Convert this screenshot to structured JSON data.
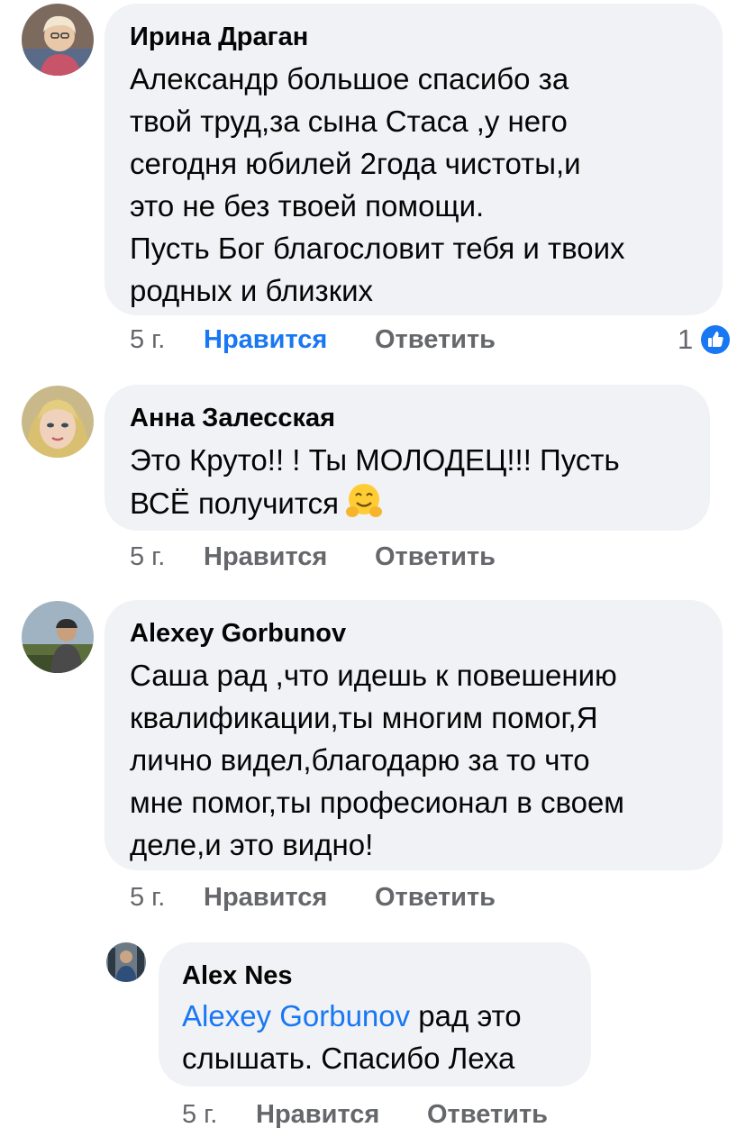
{
  "comments": [
    {
      "author": "Ирина Драган",
      "text_lines": [
        "Александр большое спасибо за",
        "твой труд,за сына Стаса ,у него",
        "сегодня юбилей 2года чистоты,и",
        "это не без твоей помощи.",
        "Пусть Бог благословит тебя и твоих",
        "родных и близких"
      ],
      "time": "5 г.",
      "like_label": "Нравится",
      "reply_label": "Ответить",
      "reaction_count": "1",
      "reaction_icon": "thumbs-up-icon"
    },
    {
      "author": "Анна Залесская",
      "text_lines": [
        "Это Круто!! ! Ты МОЛОДЕЦ!!! Пусть",
        "ВСЁ получится"
      ],
      "emoji": "hugging-face-emoji",
      "time": "5 г.",
      "like_label": "Нравится",
      "reply_label": "Ответить"
    },
    {
      "author": "Alexey Gorbunov",
      "text_lines": [
        "Саша рад ,что идешь к повешению",
        "квалификации,ты многим помог,Я",
        "лично видел,благодарю за то что",
        "мне помог,ты професионал в своем",
        "деле,и это видно!"
      ],
      "time": "5 г.",
      "like_label": "Нравится",
      "reply_label": "Ответить"
    }
  ],
  "reply": {
    "author": "Alex Nes",
    "mention": "Alexey Gorbunov",
    "text_line1_rest": " рад это",
    "text_line2": "слышать. Спасибо Леха",
    "time": "5 г.",
    "like_label": "Нравится",
    "reply_label": "Ответить"
  },
  "colors": {
    "bubble": "#f0f2f5",
    "meta_gray": "#65676b",
    "link_blue": "#1877f2"
  }
}
